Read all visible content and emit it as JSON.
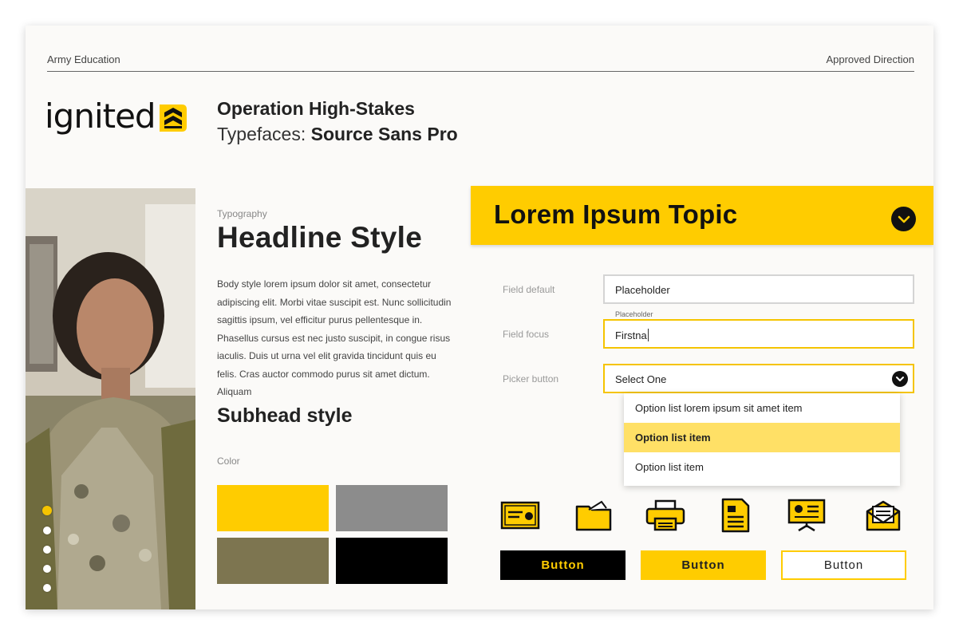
{
  "header": {
    "left": "Army Education",
    "right": "Approved Direction"
  },
  "logo": {
    "word": "ignited",
    "icon": "ignited-chevron-logo"
  },
  "project": {
    "title": "Operation High-Stakes",
    "typefaces_label": "Typefaces:",
    "typeface": "Source Sans Pro"
  },
  "carousel": {
    "dots": 5,
    "active_index": 0
  },
  "typography": {
    "label": "Typography",
    "headline": "Headline Style",
    "body": "Body style lorem ipsum dolor sit amet, consectetur adipiscing elit. Morbi vitae suscipit est. Nunc sollicitudin sagittis ipsum, vel efficitur purus pellentesque in. Phasellus cursus est nec justo suscipit, in congue risus iaculis. Duis ut urna vel elit gravida tincidunt quis eu felis. Cras auctor commodo purus sit amet dictum. Aliquam",
    "subhead": "Subhead style",
    "color_label": "Color"
  },
  "colors": [
    "#ffcc00",
    "#8c8c8c",
    "#7d7550",
    "#000000"
  ],
  "panel": {
    "topic_title": "Lorem Ipsum Topic",
    "fields": {
      "default_label": "Field default",
      "default_placeholder": "Placeholder",
      "focus_label": "Field focus",
      "focus_float_label": "Placeholder",
      "focus_value": "Firstna",
      "picker_label": "Picker button",
      "picker_value": "Select One"
    },
    "options": [
      {
        "label": "Option list lorem ipsum sit amet item",
        "selected": false
      },
      {
        "label": "Option list item",
        "selected": true
      },
      {
        "label": "Option list item",
        "selected": false
      }
    ],
    "icons": [
      "certificate-icon",
      "folder-icon",
      "printer-icon",
      "document-icon",
      "presentation-icon",
      "mail-icon"
    ],
    "buttons": {
      "black": "Button",
      "yellow": "Button",
      "outline": "Button"
    }
  },
  "accent_color": "#ffcc00"
}
